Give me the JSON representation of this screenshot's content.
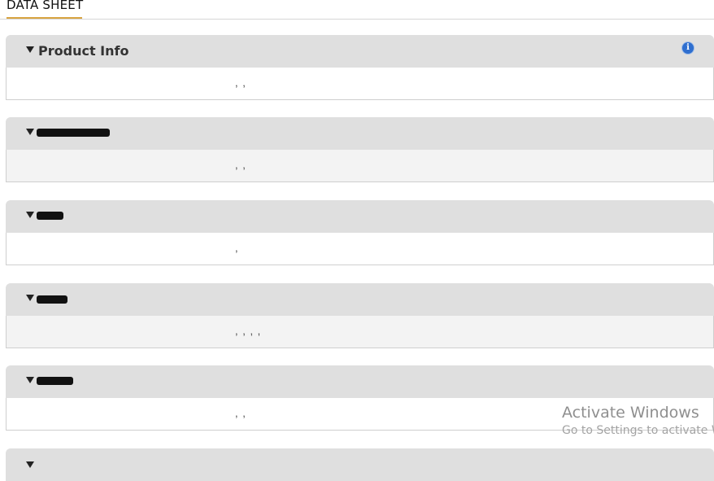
{
  "tab": {
    "title": "DATA SHEET"
  },
  "sections": [
    {
      "title": "Product Info",
      "value": ", ,",
      "redacted": false,
      "info_icon": true
    },
    {
      "title": "",
      "value": ", ,",
      "redacted": true
    },
    {
      "title": "",
      "value": ",",
      "redacted": true
    },
    {
      "title": "",
      "value": ", , , ,",
      "redacted": true
    },
    {
      "title": "",
      "value": ", ,",
      "redacted": true
    },
    {
      "title": "",
      "value": "",
      "redacted": true
    }
  ],
  "watermark": {
    "title": "Activate Windows",
    "subtitle": "Go to Settings to activate W"
  },
  "colors": {
    "header_bg": "#dfdfdf",
    "tab_underline": "#d9a441",
    "info_icon": "#2f6fcf"
  }
}
